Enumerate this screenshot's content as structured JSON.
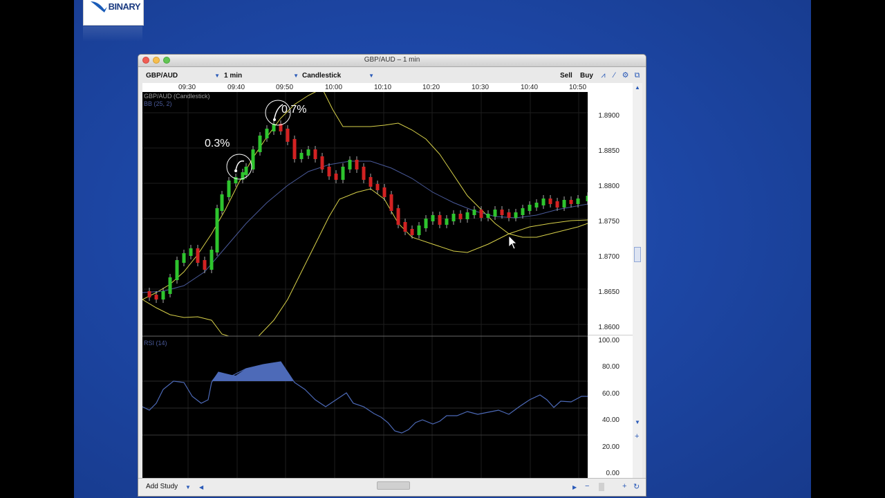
{
  "logo": {
    "text": "BINARY"
  },
  "window": {
    "title": "GBP/AUD – 1 min"
  },
  "toolbar": {
    "symbol": "GBP/AUD",
    "interval": "1 min",
    "chart_type": "Candlestick",
    "sell_label": "Sell",
    "buy_label": "Buy"
  },
  "chart": {
    "series_label": "GBP/AUD (Candlestick)",
    "bb_label": "BB (25, 2)",
    "rsi_label": "RSI (14)",
    "x_ticks": [
      "09:30",
      "09:40",
      "09:50",
      "10:00",
      "10:10",
      "10:20",
      "10:30",
      "10:40",
      "10:50"
    ],
    "price_ticks": [
      "1.8900",
      "1.8850",
      "1.8800",
      "1.8750",
      "1.8700",
      "1.8650",
      "1.8600"
    ],
    "rsi_ticks": [
      "100.00",
      "80.00",
      "60.00",
      "40.00",
      "20.00",
      "0.00"
    ],
    "annotations": {
      "first": "0.3%",
      "second": "0.7%"
    },
    "colors": {
      "up": "#2ec42e",
      "down": "#d22222",
      "band": "#d9d24a",
      "mid": "#4a5a9a",
      "rsi": "#4d6ab8"
    }
  },
  "bottom": {
    "add_study": "Add Study"
  }
}
